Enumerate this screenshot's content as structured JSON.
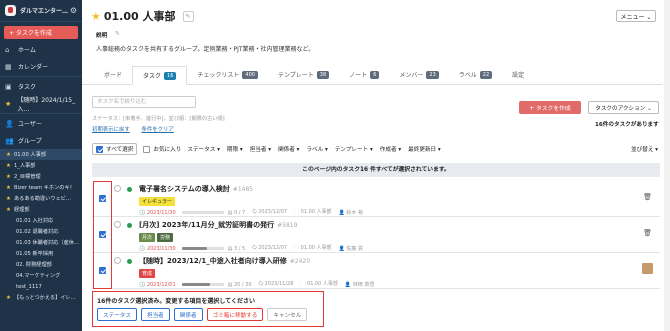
{
  "sidebar": {
    "brand": "ダルマエンター…",
    "create_label": "+ タスクを作成",
    "nav": {
      "home": "ホーム",
      "calendar": "カレンダー",
      "task": "タスク",
      "pinned_task": "【随時】2024/1/15_入…",
      "users": "ユーザー",
      "groups": "グループ"
    },
    "groups": [
      {
        "label": "01.00 人事部",
        "star": true,
        "sub": false,
        "selected": true
      },
      {
        "label": "1_人事部",
        "star": true,
        "sub": false,
        "selected": false
      },
      {
        "label": "2_目標管理",
        "star": true,
        "sub": false,
        "selected": false
      },
      {
        "label": "Bizer team キホンのキ！",
        "star": true,
        "sub": false,
        "selected": false
      },
      {
        "label": "あるある勘違いウェビ…",
        "star": true,
        "sub": false,
        "selected": false
      },
      {
        "label": "経理部",
        "star": true,
        "sub": false,
        "selected": false
      },
      {
        "label": "01.01 入社対応",
        "star": false,
        "sub": true,
        "selected": false
      },
      {
        "label": "01.02 退職者対応",
        "star": false,
        "sub": true,
        "selected": false
      },
      {
        "label": "01.03 休職者対応（産休…",
        "star": false,
        "sub": true,
        "selected": false
      },
      {
        "label": "01.05 新卒採用",
        "star": false,
        "sub": true,
        "selected": false
      },
      {
        "label": "02. 財務経理部",
        "star": false,
        "sub": true,
        "selected": false
      },
      {
        "label": "04.マーケティング",
        "star": false,
        "sub": true,
        "selected": false
      },
      {
        "label": "test_1117",
        "star": false,
        "sub": true,
        "selected": false
      },
      {
        "label": "【もっとつかえる】イレ…",
        "star": true,
        "sub": false,
        "selected": false
      }
    ]
  },
  "header": {
    "title": "01.00 人事部",
    "menu_label": "メニュー ⌄",
    "desc_label": "説明",
    "description": "人事総務のタスクを共有するグループ。定例業務・PJT業務・社内管理業務など。"
  },
  "tabs": [
    {
      "label": "ボード",
      "count": "",
      "active": false
    },
    {
      "label": "タスク",
      "count": "16",
      "active": true
    },
    {
      "label": "チェックリスト",
      "count": "400",
      "active": false
    },
    {
      "label": "テンプレート",
      "count": "38",
      "active": false
    },
    {
      "label": "ノート",
      "count": "6",
      "active": false
    },
    {
      "label": "メンバー",
      "count": "23",
      "active": false
    },
    {
      "label": "ラベル",
      "count": "22",
      "active": false
    },
    {
      "label": "設定",
      "count": "",
      "active": false
    }
  ],
  "toolbar": {
    "search_placeholder": "タスク名で絞り込む",
    "status_line": "ステータス：[未着手、進行中]，並び順：[期限の古い順]",
    "reset_link": "初期表示に戻す",
    "clear_link": "条件をクリア",
    "add_task": "+ タスクを作成",
    "task_action": "タスクのアクション ⌄",
    "task_count": "16件のタスクがあります"
  },
  "filters": {
    "select_all": "すべて選択",
    "favorite": "お気に入り",
    "items": [
      "ステータス ▾",
      "期限 ▾",
      "担当者 ▾",
      "関係者 ▾",
      "ラベル ▾",
      "テンプレート ▾",
      "作成者 ▾",
      "最終更新日 ▾"
    ],
    "sort": "並び替え ▾"
  },
  "notice": "このページ内のタスク16 件すべてが選択されています。",
  "tasks": [
    {
      "title": "電子署名システムの導入検討",
      "num": "#1485",
      "tags": [
        {
          "label": "イレギュラー",
          "color": "yellow"
        }
      ],
      "due": "2023/11/30",
      "progress": "0 / 7",
      "progress_value": 0,
      "updated": "2023/12/07",
      "group": "01.00 人事部",
      "assignee": "鈴木 裕",
      "right_icon": "trash-icon"
    },
    {
      "title": "[月次] 2023年/11月分_就労証明書の発行",
      "num": "#5819",
      "tags": [
        {
          "label": "月次",
          "color": "green"
        },
        {
          "label": "労務",
          "color": "dgreen"
        }
      ],
      "due": "2023/11/30",
      "progress": "3 / 5",
      "progress_value": 0.6,
      "updated": "2023/12/07",
      "group": "01.00 人事部",
      "assignee": "佐藤 貢",
      "right_icon": "trash-icon"
    },
    {
      "title": "【随時】2023/12/1_中途入社者向け導入研修",
      "num": "#2420",
      "tags": [
        {
          "label": "育成",
          "color": "red"
        }
      ],
      "due": "2023/12/01",
      "progress": "20 / 30",
      "progress_value": 0.67,
      "updated": "2023/11/28",
      "group": "01.00 人事部",
      "assignee": "林崎 真悟",
      "right_icon": "avatar"
    }
  ],
  "bottom_panel": {
    "text": "16件のタスク選択済み。変更する項目を選択してください",
    "buttons": [
      {
        "label": "ステータス",
        "kind": "normal"
      },
      {
        "label": "担当者",
        "kind": "normal"
      },
      {
        "label": "関係者",
        "kind": "normal"
      },
      {
        "label": "ゴミ箱に移動する",
        "kind": "danger"
      },
      {
        "label": "キャンセル",
        "kind": "cancel"
      }
    ]
  }
}
